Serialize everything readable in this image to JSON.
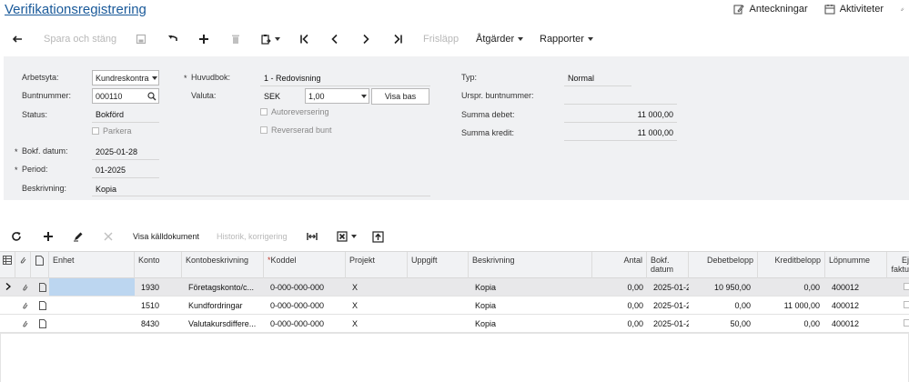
{
  "page": {
    "title": "Verifikationsregistrering"
  },
  "top_links": {
    "notes": "Anteckningar",
    "activities": "Aktiviteter"
  },
  "toolbar": {
    "save_close": "Spara och stäng",
    "release": "Frisläpp",
    "actions": "Åtgärder",
    "reports": "Rapporter"
  },
  "form": {
    "workspace_label": "Arbetsyta:",
    "workspace_value": "Kundreskontra",
    "batch_label": "Buntnummer:",
    "batch_value": "000110",
    "status_label": "Status:",
    "status_value": "Bokförd",
    "hold_label": "Parkera",
    "date_label": "Bokf. datum:",
    "date_value": "2025-01-28",
    "period_label": "Period:",
    "period_value": "01-2025",
    "desc_label": "Beskrivning:",
    "desc_value": "Kopia",
    "ledger_label": "Huvudbok:",
    "ledger_value": "1 - Redovisning",
    "currency_label": "Valuta:",
    "currency_value": "SEK",
    "rate_value": "1,00",
    "show_base": "Visa bas",
    "auto_reversal": "Autoreversering",
    "reversed_batch": "Reverserad bunt",
    "type_label": "Typ:",
    "type_value": "Normal",
    "orig_batch_label": "Urspr. buntnummer:",
    "debit_label": "Summa debet:",
    "debit_value": "11 000,00",
    "credit_label": "Summa kredit:",
    "credit_value": "11 000,00"
  },
  "grid_toolbar": {
    "view_source": "Visa källdokument",
    "history": "Historik, korrigering"
  },
  "grid": {
    "headers": {
      "unit": "Enhet",
      "account": "Konto",
      "account_desc": "Kontobeskrivning",
      "subaccount": "Koddel",
      "project": "Projekt",
      "task": "Uppgift",
      "description": "Beskrivning",
      "qty": "Antal",
      "date_l1": "Bokf.",
      "date_l2": "datum",
      "debit": "Debetbelopp",
      "credit": "Kreditbelopp",
      "line_no": "Löpnumme",
      "nb_l1": "Ej",
      "nb_l2": "faktu"
    },
    "rows": [
      {
        "unit": "",
        "account": "1930",
        "account_desc": "Företagskonto/c...",
        "subaccount": "0-000-000-000",
        "project": "X",
        "task": "",
        "description": "Kopia",
        "qty": "0,00",
        "date": "2025-01-2",
        "debit": "10 950,00",
        "credit": "0,00",
        "line_no": "400012"
      },
      {
        "unit": "",
        "account": "1510",
        "account_desc": "Kundfordringar",
        "subaccount": "0-000-000-000",
        "project": "X",
        "task": "",
        "description": "Kopia",
        "qty": "0,00",
        "date": "2025-01-2",
        "debit": "0,00",
        "credit": "11 000,00",
        "line_no": "400012"
      },
      {
        "unit": "",
        "account": "8430",
        "account_desc": "Valutakursdiffere...",
        "subaccount": "0-000-000-000",
        "project": "X",
        "task": "",
        "description": "Kopia",
        "qty": "0,00",
        "date": "2025-01-2",
        "debit": "50,00",
        "credit": "0,00",
        "line_no": "400012"
      }
    ]
  }
}
